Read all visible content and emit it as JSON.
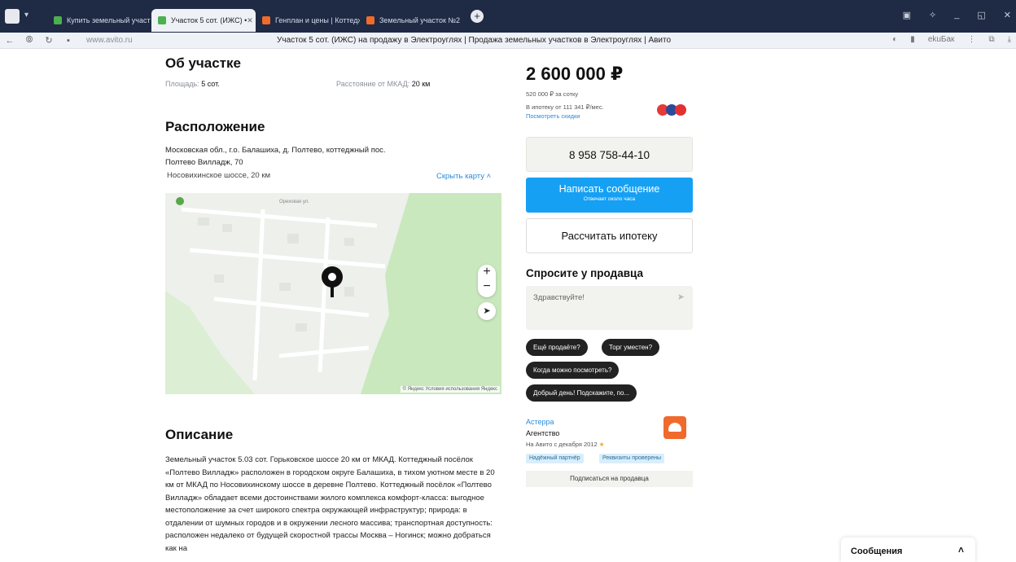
{
  "browser": {
    "tabs": [
      {
        "label": "Купить земельный участ",
        "color": "#4caf50"
      },
      {
        "label": "Участок 5 сот. (ИЖС) •",
        "color": "#4caf50"
      },
      {
        "label": "Генплан и цены | Коттедж",
        "color": "#f06b2a"
      },
      {
        "label": "Земельный участок №2",
        "color": "#f06b2a"
      }
    ],
    "url": "www.avito.ru",
    "page_title": "Участок 5 сот. (ИЖС) на продажу в Электроуглях | Продажа земельных участков в Электроуглях | Авито",
    "extension_label": "ekuБак"
  },
  "about": {
    "title": "Об участке",
    "area_label": "Площадь: ",
    "area_value": "5 сот.",
    "distance_label": "Расстояние от МКАД: ",
    "distance_value": "20 км"
  },
  "location": {
    "title": "Расположение",
    "address_line1": "Московская обл., г.о. Балашиха, д. Полтево, коттеджный пос.",
    "address_line2": "Полтево Вилладж, 70",
    "highway": "Носовихинское шоссе, 20 км",
    "hide_map": "Скрыть карту ˄",
    "map_footer": "© Яндекс  Условия использования  Яндекс",
    "map_label_top": "Ореховая ул."
  },
  "description": {
    "title": "Описание",
    "text": "Земельный участок 5.03 сот. Горьковское шоссе 20 км от МКАД. Коттеджный посёлок «Полтево Вилладж» расположен в городском округе Балашиха, в тихом уютном месте в 20 км от МКАД по Носовихинскому шоссе в деревне Полтево. Коттеджный посёлок «Полтево Вилладж» обладает всеми достоинствами жилого комплекса комфорт-класса: выгодное местоположение за счет широкого спектра окружающей инфраструктур; природа: в отдалении от шумных городов и в окружении лесного массива; транспортная доступность: расположен недалеко от будущей скоростной трассы Москва – Ногинск; можно добраться как на"
  },
  "offer": {
    "price": "2 600 000 ₽",
    "per_sotka": "520 000 ₽ за сотку",
    "mortgage": "В ипотеку от 111 341 ₽/мес.",
    "discounts_link": "Посмотреть скидки",
    "phone": "8 958 758-44-10",
    "write_label": "Написать сообщение",
    "write_sub": "Отвечает около часа",
    "mortgage_btn": "Рассчитать ипотеку"
  },
  "ask": {
    "title": "Спросите у продавца",
    "placeholder": "Здравствуйте!",
    "chips": [
      "Ещё продаёте?",
      "Торг уместен?",
      "Когда можно посмотреть?",
      "Добрый день! Подскажите, по..."
    ]
  },
  "seller": {
    "name": "Астерра",
    "type": "Агентство",
    "since": "На Авито с декабря 2012",
    "badge1": "Надёжный партнёр",
    "badge2": "Реквизиты проверены",
    "subscribe": "Подписаться на продавца"
  },
  "messages": {
    "label": "Сообщения"
  },
  "colors": {
    "accent": "#16a0f4",
    "forest": "#c9e8bd"
  }
}
